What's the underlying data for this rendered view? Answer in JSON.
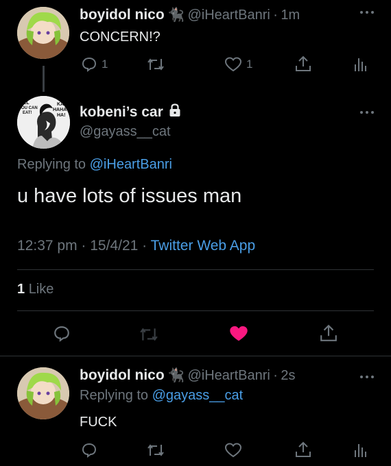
{
  "tweet1": {
    "display_name": "boyidol nico",
    "handle": "@iHeartBanri",
    "time": "1m",
    "text": "CONCERN!?",
    "reply_count": "1",
    "like_count": "1"
  },
  "main": {
    "display_name": "kobeni’s car",
    "handle": "@gayass__cat",
    "replying_prefix": "Replying to",
    "replying_to": "@iHeartBanri",
    "text": "u have lots of issues man",
    "time": "12:37 pm",
    "date": "15/4/21",
    "source": "Twitter Web App",
    "likes_number": "1",
    "likes_label": "Like",
    "avatar_text": [
      "ALL",
      "YOU CAN",
      "EAT!",
      "KA",
      "HAHA",
      "HA!"
    ],
    "heart_color": "#f91880"
  },
  "reply": {
    "display_name": "boyidol nico",
    "handle": "@iHeartBanri",
    "time": "2s",
    "replying_prefix": "Replying to",
    "replying_to": "@gayass__cat",
    "text": "FUCK"
  },
  "separator": "·",
  "colors": {
    "muted": "#6e767d",
    "link": "#4a9ee6",
    "accent_like": "#f91880"
  }
}
